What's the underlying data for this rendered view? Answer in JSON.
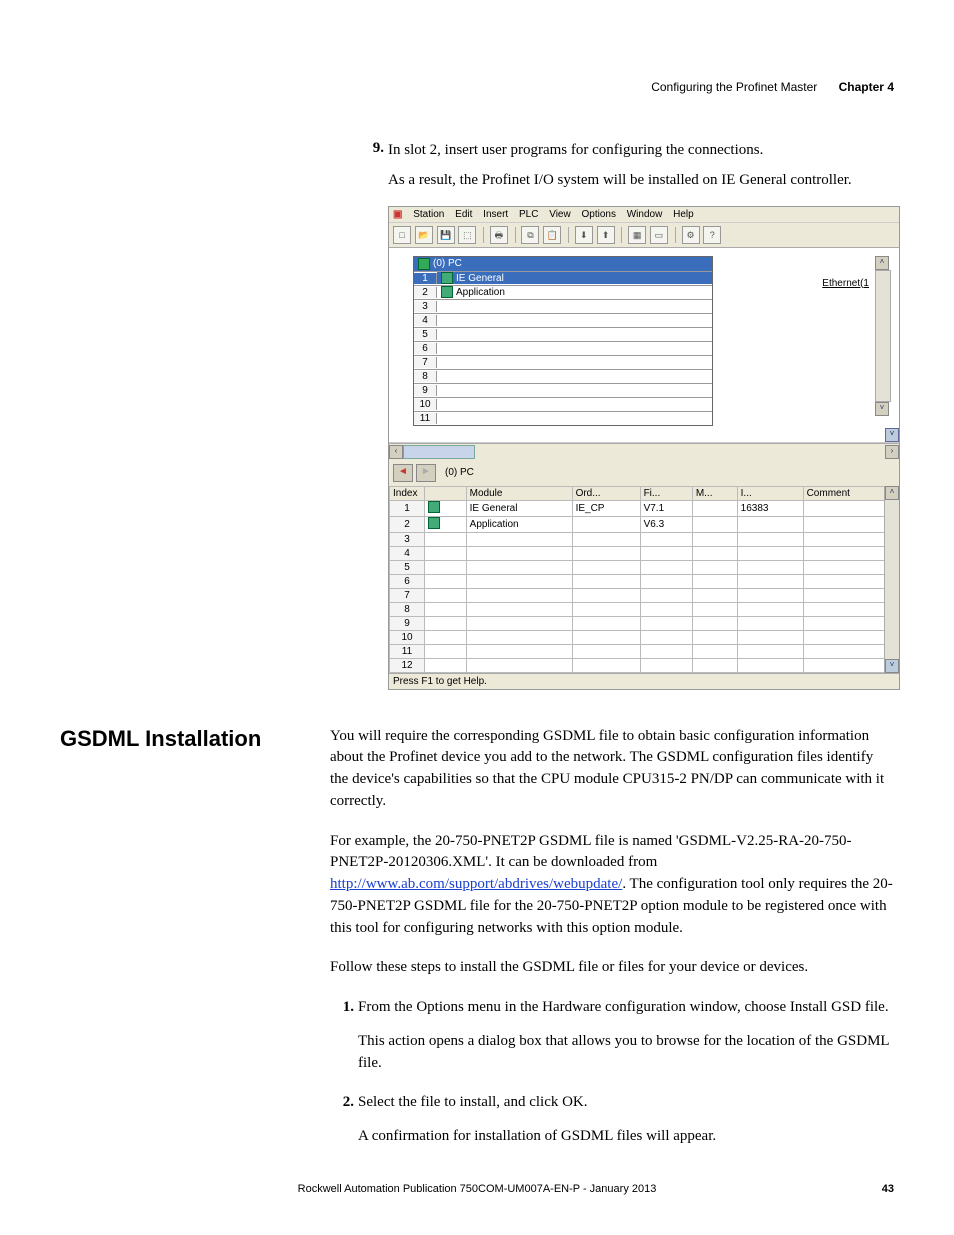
{
  "header": {
    "text": "Configuring the Profinet Master",
    "chapter": "Chapter 4"
  },
  "step9": {
    "num": "9.",
    "text": "In slot 2, insert user programs for configuring the connections.",
    "result": "As a result, the Profinet I/O system will be installed on IE General controller."
  },
  "screenshot": {
    "menu": [
      "Station",
      "Edit",
      "Insert",
      "PLC",
      "View",
      "Options",
      "Window",
      "Help"
    ],
    "rack_title": "(0) PC",
    "eth": "Ethernet(1",
    "rack_rows": [
      {
        "n": "1",
        "mod": "IE General",
        "sel": true,
        "icon": true
      },
      {
        "n": "2",
        "mod": "Application",
        "sel": false,
        "icon": true
      },
      {
        "n": "3",
        "mod": "",
        "sel": false
      },
      {
        "n": "4",
        "mod": "",
        "sel": false
      },
      {
        "n": "5",
        "mod": "",
        "sel": false
      },
      {
        "n": "6",
        "mod": "",
        "sel": false
      },
      {
        "n": "7",
        "mod": "",
        "sel": false
      },
      {
        "n": "8",
        "mod": "",
        "sel": false
      },
      {
        "n": "9",
        "mod": "",
        "sel": false
      },
      {
        "n": "10",
        "mod": "",
        "sel": false
      },
      {
        "n": "11",
        "mod": "",
        "sel": false
      }
    ],
    "lower_title": "(0)  PC",
    "grid_headers": [
      "Index",
      "",
      "Module",
      "Ord...",
      "Fi...",
      "M...",
      "I...",
      "Comment"
    ],
    "grid_rows": [
      {
        "idx": "1",
        "icon": true,
        "module": "IE General",
        "ord": "IE_CP",
        "fi": "V7.1",
        "m": "",
        "i": "16383",
        "c": ""
      },
      {
        "idx": "2",
        "icon": true,
        "module": "Application",
        "ord": "",
        "fi": "V6.3",
        "m": "",
        "i": "",
        "c": ""
      },
      {
        "idx": "3"
      },
      {
        "idx": "4"
      },
      {
        "idx": "5"
      },
      {
        "idx": "6"
      },
      {
        "idx": "7"
      },
      {
        "idx": "8"
      },
      {
        "idx": "9"
      },
      {
        "idx": "10"
      },
      {
        "idx": "11"
      },
      {
        "idx": "12"
      }
    ],
    "status": "Press F1 to get Help."
  },
  "section": {
    "heading": "GSDML Installation",
    "p1": "You will require the corresponding GSDML file to obtain basic configuration information about the Profinet device you add to the network. The GSDML configuration files identify the device's capabilities so that the CPU module CPU315-2 PN/DP can communicate with it correctly.",
    "p2a": "For example, the 20-750-PNET2P GSDML file is named 'GSDML-V2.25-RA-20-750-PNET2P-20120306.XML'. It can be downloaded from ",
    "link": "http://www.ab.com/support/abdrives/webupdate/",
    "p2b": ". The configuration tool only requires the 20-750-PNET2P GSDML file for the 20-750-PNET2P option module to be registered once with this tool for configuring networks with this option module.",
    "p3": "Follow these steps to install the GSDML file or files for your device or devices.",
    "step1": {
      "n": "1.",
      "text": "From the Options menu in the Hardware configuration window, choose Install GSD file.",
      "after": "This action opens a dialog box that allows you to browse for the location of the GSDML file."
    },
    "step2": {
      "n": "2.",
      "text": "Select the file to install, and click OK.",
      "after": "A confirmation for installation of GSDML files will appear."
    }
  },
  "footer": {
    "text": "Rockwell Automation Publication 750COM-UM007A-EN-P - January 2013",
    "page": "43"
  }
}
